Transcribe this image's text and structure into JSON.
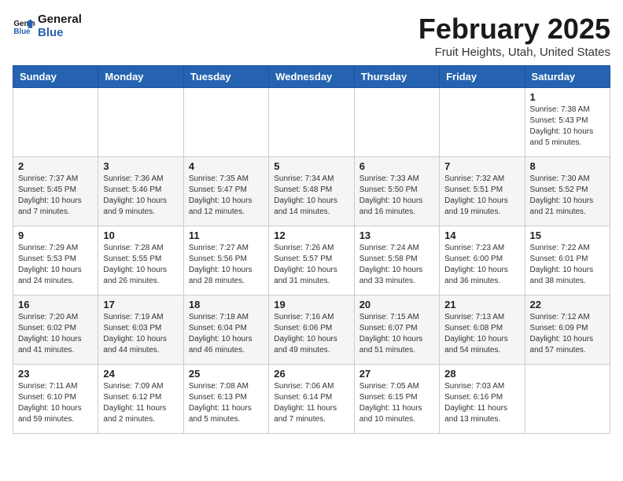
{
  "logo": {
    "line1": "General",
    "line2": "Blue"
  },
  "title": "February 2025",
  "subtitle": "Fruit Heights, Utah, United States",
  "weekdays": [
    "Sunday",
    "Monday",
    "Tuesday",
    "Wednesday",
    "Thursday",
    "Friday",
    "Saturday"
  ],
  "weeks": [
    [
      {
        "day": "",
        "info": ""
      },
      {
        "day": "",
        "info": ""
      },
      {
        "day": "",
        "info": ""
      },
      {
        "day": "",
        "info": ""
      },
      {
        "day": "",
        "info": ""
      },
      {
        "day": "",
        "info": ""
      },
      {
        "day": "1",
        "info": "Sunrise: 7:38 AM\nSunset: 5:43 PM\nDaylight: 10 hours and 5 minutes."
      }
    ],
    [
      {
        "day": "2",
        "info": "Sunrise: 7:37 AM\nSunset: 5:45 PM\nDaylight: 10 hours and 7 minutes."
      },
      {
        "day": "3",
        "info": "Sunrise: 7:36 AM\nSunset: 5:46 PM\nDaylight: 10 hours and 9 minutes."
      },
      {
        "day": "4",
        "info": "Sunrise: 7:35 AM\nSunset: 5:47 PM\nDaylight: 10 hours and 12 minutes."
      },
      {
        "day": "5",
        "info": "Sunrise: 7:34 AM\nSunset: 5:48 PM\nDaylight: 10 hours and 14 minutes."
      },
      {
        "day": "6",
        "info": "Sunrise: 7:33 AM\nSunset: 5:50 PM\nDaylight: 10 hours and 16 minutes."
      },
      {
        "day": "7",
        "info": "Sunrise: 7:32 AM\nSunset: 5:51 PM\nDaylight: 10 hours and 19 minutes."
      },
      {
        "day": "8",
        "info": "Sunrise: 7:30 AM\nSunset: 5:52 PM\nDaylight: 10 hours and 21 minutes."
      }
    ],
    [
      {
        "day": "9",
        "info": "Sunrise: 7:29 AM\nSunset: 5:53 PM\nDaylight: 10 hours and 24 minutes."
      },
      {
        "day": "10",
        "info": "Sunrise: 7:28 AM\nSunset: 5:55 PM\nDaylight: 10 hours and 26 minutes."
      },
      {
        "day": "11",
        "info": "Sunrise: 7:27 AM\nSunset: 5:56 PM\nDaylight: 10 hours and 28 minutes."
      },
      {
        "day": "12",
        "info": "Sunrise: 7:26 AM\nSunset: 5:57 PM\nDaylight: 10 hours and 31 minutes."
      },
      {
        "day": "13",
        "info": "Sunrise: 7:24 AM\nSunset: 5:58 PM\nDaylight: 10 hours and 33 minutes."
      },
      {
        "day": "14",
        "info": "Sunrise: 7:23 AM\nSunset: 6:00 PM\nDaylight: 10 hours and 36 minutes."
      },
      {
        "day": "15",
        "info": "Sunrise: 7:22 AM\nSunset: 6:01 PM\nDaylight: 10 hours and 38 minutes."
      }
    ],
    [
      {
        "day": "16",
        "info": "Sunrise: 7:20 AM\nSunset: 6:02 PM\nDaylight: 10 hours and 41 minutes."
      },
      {
        "day": "17",
        "info": "Sunrise: 7:19 AM\nSunset: 6:03 PM\nDaylight: 10 hours and 44 minutes."
      },
      {
        "day": "18",
        "info": "Sunrise: 7:18 AM\nSunset: 6:04 PM\nDaylight: 10 hours and 46 minutes."
      },
      {
        "day": "19",
        "info": "Sunrise: 7:16 AM\nSunset: 6:06 PM\nDaylight: 10 hours and 49 minutes."
      },
      {
        "day": "20",
        "info": "Sunrise: 7:15 AM\nSunset: 6:07 PM\nDaylight: 10 hours and 51 minutes."
      },
      {
        "day": "21",
        "info": "Sunrise: 7:13 AM\nSunset: 6:08 PM\nDaylight: 10 hours and 54 minutes."
      },
      {
        "day": "22",
        "info": "Sunrise: 7:12 AM\nSunset: 6:09 PM\nDaylight: 10 hours and 57 minutes."
      }
    ],
    [
      {
        "day": "23",
        "info": "Sunrise: 7:11 AM\nSunset: 6:10 PM\nDaylight: 10 hours and 59 minutes."
      },
      {
        "day": "24",
        "info": "Sunrise: 7:09 AM\nSunset: 6:12 PM\nDaylight: 11 hours and 2 minutes."
      },
      {
        "day": "25",
        "info": "Sunrise: 7:08 AM\nSunset: 6:13 PM\nDaylight: 11 hours and 5 minutes."
      },
      {
        "day": "26",
        "info": "Sunrise: 7:06 AM\nSunset: 6:14 PM\nDaylight: 11 hours and 7 minutes."
      },
      {
        "day": "27",
        "info": "Sunrise: 7:05 AM\nSunset: 6:15 PM\nDaylight: 11 hours and 10 minutes."
      },
      {
        "day": "28",
        "info": "Sunrise: 7:03 AM\nSunset: 6:16 PM\nDaylight: 11 hours and 13 minutes."
      },
      {
        "day": "",
        "info": ""
      }
    ]
  ]
}
